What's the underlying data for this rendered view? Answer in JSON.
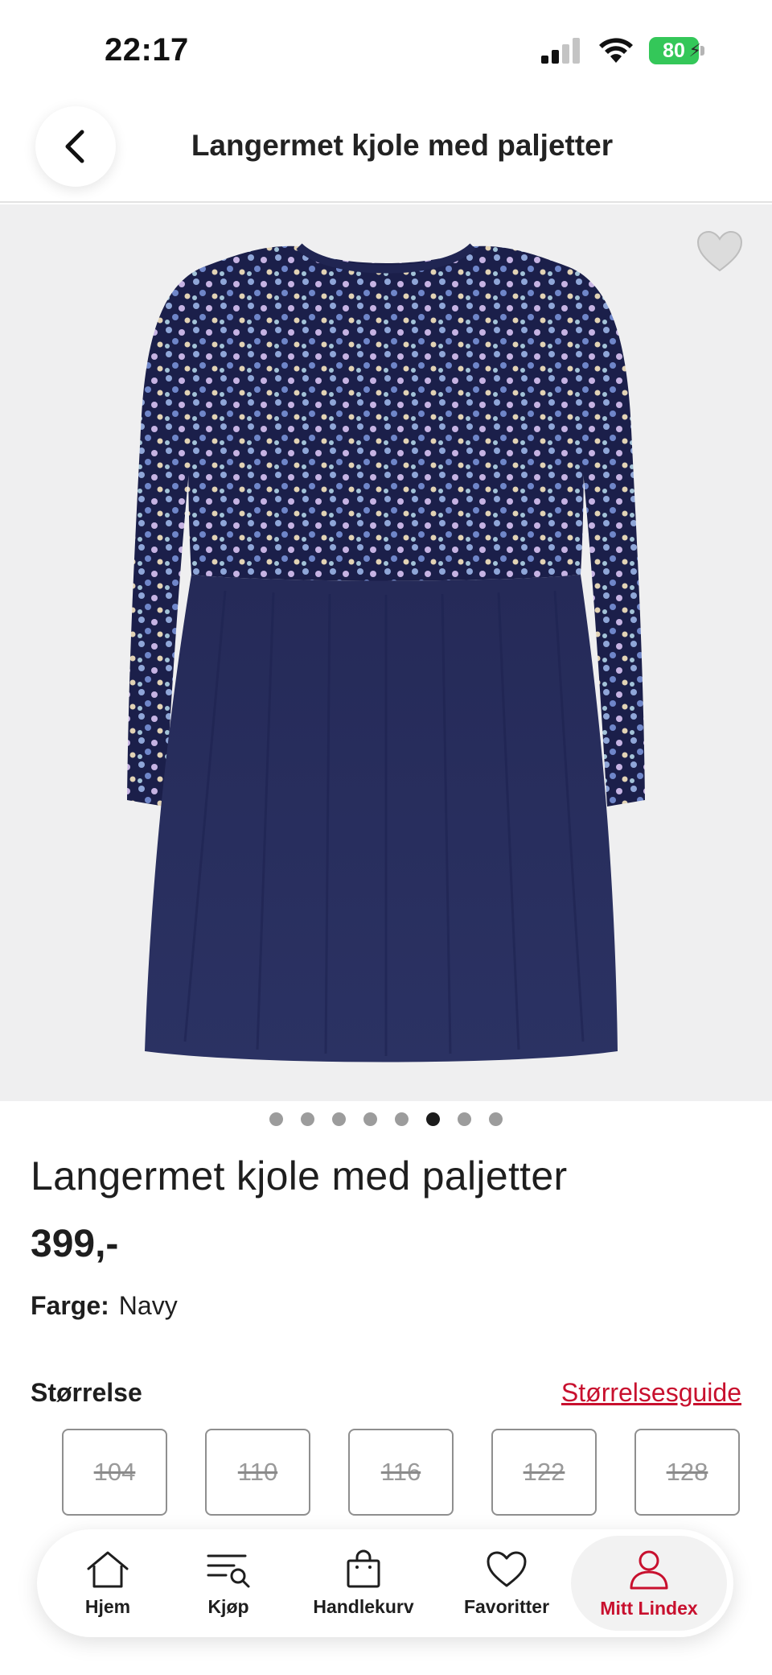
{
  "status_bar": {
    "time": "22:17",
    "battery": "80"
  },
  "header": {
    "title": "Langermet kjole med paljetter"
  },
  "carousel": {
    "count": 8,
    "active_index": 5
  },
  "product": {
    "name": "Langermet kjole med paljetter",
    "price": "399,-",
    "color_label": "Farge:",
    "color_value": "Navy"
  },
  "size": {
    "title": "Størrelse",
    "guide_link": "Størrelsesguide",
    "options": [
      "104",
      "110",
      "116",
      "122",
      "128"
    ]
  },
  "bottom_nav": {
    "items": [
      {
        "label": "Hjem",
        "icon": "home-icon"
      },
      {
        "label": "Kjøp",
        "icon": "search-list-icon"
      },
      {
        "label": "Handlekurv",
        "icon": "shopping-bag-icon"
      },
      {
        "label": "Favoritter",
        "icon": "heart-icon"
      },
      {
        "label": "Mitt Lindex",
        "icon": "user-icon"
      }
    ],
    "active": "Mitt Lindex"
  },
  "colors": {
    "accent": "#c8102e",
    "battery": "#34c759",
    "dress": "#1e2450"
  }
}
